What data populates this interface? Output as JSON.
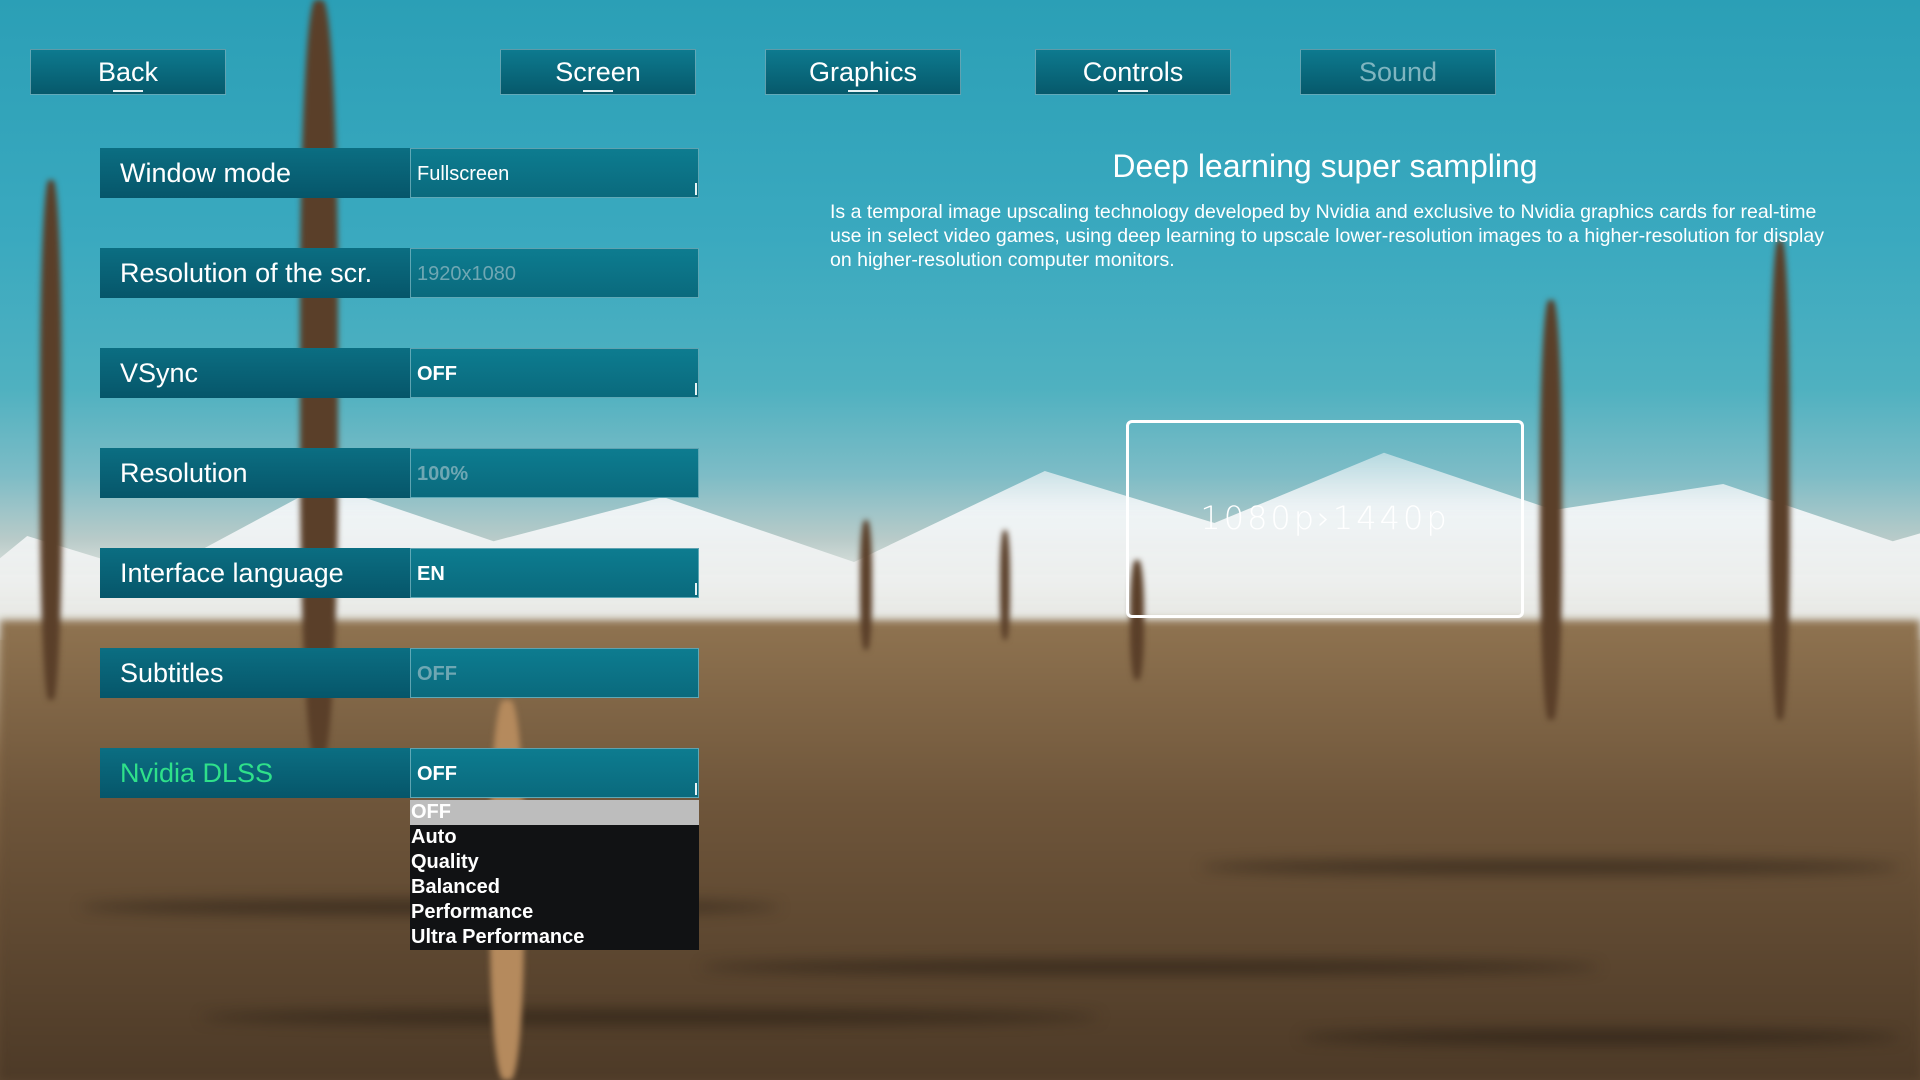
{
  "nav": {
    "back": "Back",
    "tabs": [
      "Screen",
      "Graphics",
      "Controls",
      "Sound"
    ]
  },
  "settings": [
    {
      "label": "Window mode",
      "value": "Fullscreen"
    },
    {
      "label": "Resolution of the scr.",
      "value": "1920x1080"
    },
    {
      "label": "VSync",
      "value": "OFF"
    },
    {
      "label": "Resolution",
      "value": "100%"
    },
    {
      "label": "Interface language",
      "value": "EN"
    },
    {
      "label": "Subtitles",
      "value": "OFF"
    },
    {
      "label": "Nvidia DLSS",
      "value": "OFF"
    }
  ],
  "dropdown": {
    "selected": "OFF",
    "options": [
      "OFF",
      "Auto",
      "Quality",
      "Balanced",
      "Performance",
      "Ultra Performance"
    ]
  },
  "description": {
    "title": "Deep learning super sampling",
    "body": "Is a temporal image upscaling technology developed by Nvidia and exclusive to Nvidia graphics cards for real-time use in select video games, using deep learning to upscale lower-resolution images to a higher-resolution for display on higher-resolution computer monitors.",
    "preview": "1080p›1440p"
  },
  "colors": {
    "panel": "#06596b",
    "active_label": "#2fe08a",
    "dropdown_bg": "#111214",
    "dropdown_selected": "#bdbdbd"
  }
}
